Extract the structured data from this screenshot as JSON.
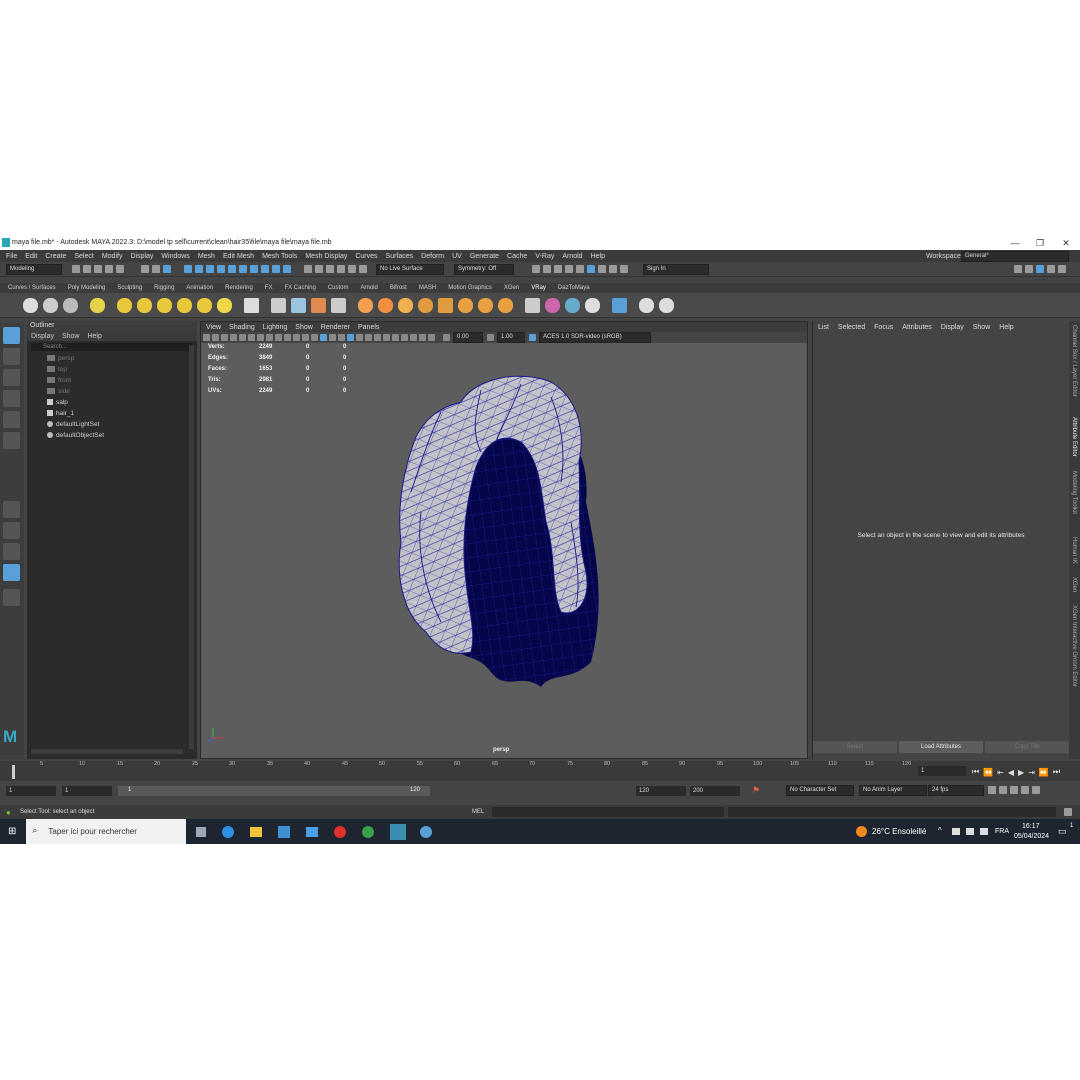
{
  "window": {
    "title": "maya file.mb* - Autodesk MAYA 2022.3: D:\\model tp sell\\current\\clean\\hair35\\file\\maya file\\maya file.mb",
    "minimize": "—",
    "restore": "❐",
    "close": "✕"
  },
  "menus": [
    "File",
    "Edit",
    "Create",
    "Select",
    "Modify",
    "Display",
    "Windows",
    "Mesh",
    "Edit Mesh",
    "Mesh Tools",
    "Mesh Display",
    "Curves",
    "Surfaces",
    "Deform",
    "UV",
    "Generate",
    "Cache",
    "V-Ray",
    "Arnold",
    "Help"
  ],
  "workspace": {
    "label": "Workspace:",
    "value": "General*"
  },
  "status": {
    "mode": "Modeling",
    "live_surface": "No Live Surface",
    "symmetry": "Symmetry: Off",
    "sign_in": "Sign In"
  },
  "shelf_tabs": [
    "Curves / Surfaces",
    "Poly Modeling",
    "Sculpting",
    "Rigging",
    "Animation",
    "Rendering",
    "FX",
    "FX Caching",
    "Custom",
    "Arnold",
    "Bifrost",
    "MASH",
    "Motion Graphics",
    "XGen",
    "VRay",
    "DazToMaya"
  ],
  "active_shelf": "VRay",
  "outliner": {
    "title": "Outliner",
    "menus": [
      "Display",
      "Show",
      "Help"
    ],
    "search_placeholder": "Search...",
    "items": [
      "persp",
      "top",
      "front",
      "side",
      "salp",
      "hair_1",
      "defaultLightSet",
      "defaultObjectSet"
    ]
  },
  "viewport": {
    "menus": [
      "View",
      "Shading",
      "Lighting",
      "Show",
      "Renderer",
      "Panels"
    ],
    "exposure": "0.00",
    "gamma": "1.00",
    "color_space": "ACES 1.0 SDR-video (sRGB)",
    "camera": "persp",
    "stats": [
      {
        "label": "Verts:",
        "a": "2249",
        "b": "0",
        "c": "0"
      },
      {
        "label": "Edges:",
        "a": "3849",
        "b": "0",
        "c": "0"
      },
      {
        "label": "Faces:",
        "a": "1653",
        "b": "0",
        "c": "0"
      },
      {
        "label": "Tris:",
        "a": "2981",
        "b": "0",
        "c": "0"
      },
      {
        "label": "UVs:",
        "a": "2249",
        "b": "0",
        "c": "0"
      }
    ]
  },
  "attribute_editor": {
    "menus": [
      "List",
      "Selected",
      "Focus",
      "Attributes",
      "Display",
      "Show",
      "Help"
    ],
    "message": "Select an object in the scene to view and edit its attributes",
    "buttons": [
      "Select",
      "Load Attributes",
      "Copy Tab"
    ]
  },
  "side_tabs": [
    "Channel Box / Layer Editor",
    "Attribute Editor",
    "Modeling Toolkit",
    "Human IK",
    "XGen",
    "XGen Interactive Groom Editor"
  ],
  "timeline": {
    "ticks": [
      "5",
      "10",
      "15",
      "20",
      "25",
      "30",
      "35",
      "40",
      "45",
      "50",
      "55",
      "60",
      "65",
      "70",
      "75",
      "80",
      "85",
      "90",
      "95",
      "100",
      "105",
      "110",
      "115",
      "120"
    ],
    "current_frame": "1"
  },
  "range": {
    "start": "1",
    "start2": "1",
    "slider_start": "1",
    "slider_end": "120",
    "end": "120",
    "end2": "200",
    "character_set": "No Character Set",
    "anim_layer": "No Anim Layer",
    "fps": "24 fps"
  },
  "help_line": {
    "text": "Select Tool: select an object",
    "mel": "MEL"
  },
  "taskbar": {
    "search_placeholder": "Taper ici pour rechercher",
    "weather": "26°C  Ensoleillé",
    "lang": "FRA",
    "time": "16:17",
    "date": "05/04/2024",
    "notif": "1"
  },
  "colors": {
    "accent": "#5aa0d8",
    "viewport_bg": "#5d5d5d",
    "panel_bg": "#444444",
    "mesh_wire": "#1a1aa0"
  }
}
